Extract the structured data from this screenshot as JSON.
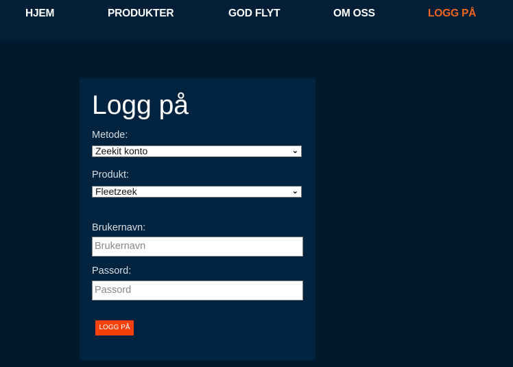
{
  "nav": {
    "items": [
      {
        "label": "HJEM"
      },
      {
        "label": "PRODUKTER"
      },
      {
        "label": "GOD FLYT"
      },
      {
        "label": "OM OSS"
      },
      {
        "label": "LOGG PÅ",
        "active": true
      }
    ]
  },
  "form": {
    "title": "Logg på",
    "method_label": "Metode:",
    "method_value": "Zeekit konto",
    "product_label": "Produkt:",
    "product_value": "Fleetzeek",
    "username_label": "Brukernavn:",
    "username_placeholder": "Brukernavn",
    "password_label": "Passord:",
    "password_placeholder": "Passord",
    "submit_label": "LOGG PÅ"
  },
  "colors": {
    "accent": "#f5400b",
    "active_nav": "#f2661f",
    "panel": "#00233f",
    "header": "#021f37",
    "background": "#02182d"
  }
}
